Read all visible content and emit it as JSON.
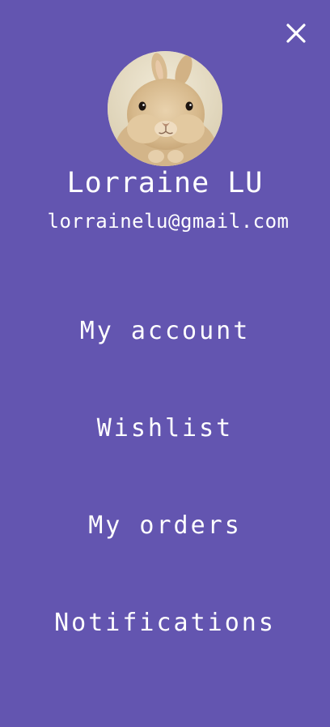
{
  "profile": {
    "name": "Lorraine LU",
    "email": "lorrainelu@gmail.com",
    "avatar_icon": "rabbit-photo"
  },
  "menu": {
    "items": [
      {
        "label": "My account"
      },
      {
        "label": "Wishlist"
      },
      {
        "label": "My orders"
      },
      {
        "label": "Notifications"
      }
    ]
  },
  "icons": {
    "close": "close-icon"
  },
  "colors": {
    "background": "#6355b0",
    "text": "#ffffff"
  }
}
